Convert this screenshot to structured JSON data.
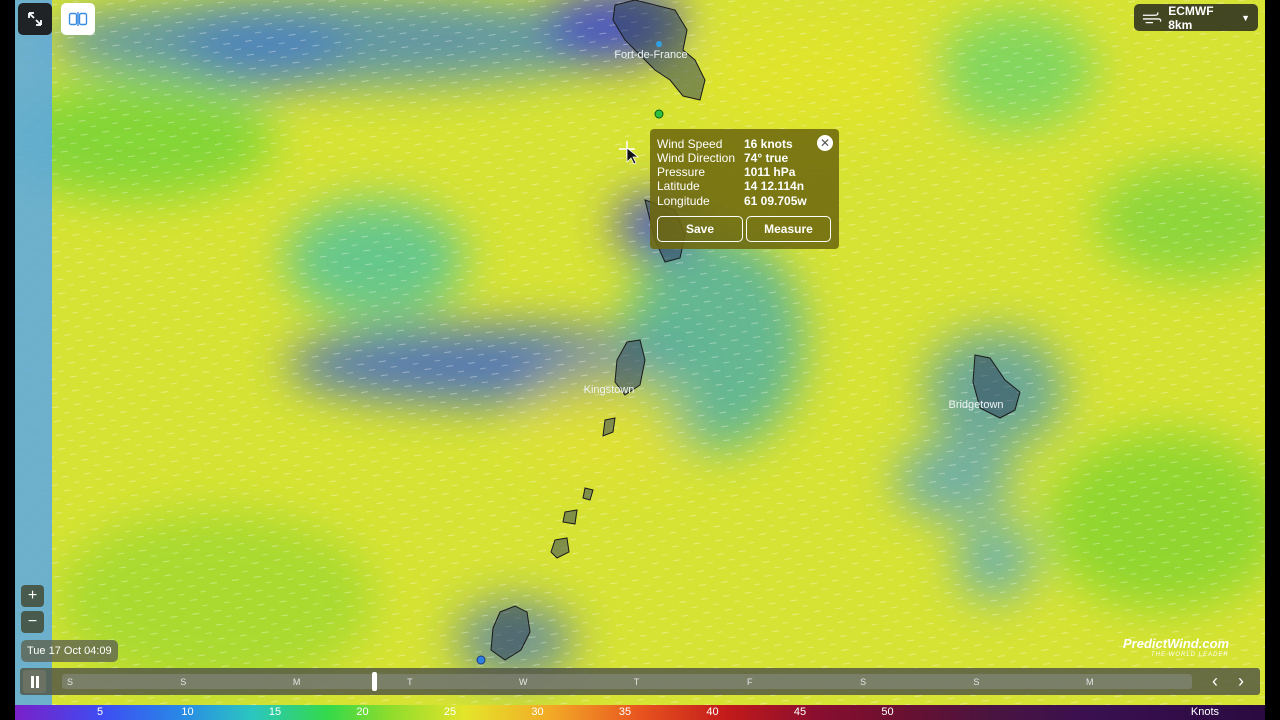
{
  "map": {
    "cities": [
      {
        "name": "Fort-de-France"
      },
      {
        "name": "Kingstown"
      },
      {
        "name": "Bridgetown"
      }
    ]
  },
  "toolbar": {
    "fullscreen_icon": "expand-arrows-icon",
    "split_icon": "split-view-icon",
    "model_label": "ECMWF 8km",
    "model_icon": "wind-lines-icon"
  },
  "zoom": {
    "in_label": "+",
    "out_label": "−"
  },
  "current_time": "Tue 17 Oct 04:09",
  "popup": {
    "rows": [
      {
        "label": "Wind Speed",
        "value": "16 knots"
      },
      {
        "label": "Wind Direction",
        "value": "74° true"
      },
      {
        "label": "Pressure",
        "value": "1011 hPa"
      },
      {
        "label": "Latitude",
        "value": "14 12.114n"
      },
      {
        "label": "Longitude",
        "value": "61 09.705w"
      }
    ],
    "save_label": "Save",
    "measure_label": "Measure",
    "close_icon": "close-icon"
  },
  "timeline": {
    "days": [
      "S",
      "S",
      "M",
      "T",
      "W",
      "T",
      "F",
      "S",
      "S",
      "M"
    ],
    "position_fraction": 0.276,
    "play_icon": "pause-icon"
  },
  "legend": {
    "ticks": [
      "5",
      "10",
      "15",
      "20",
      "25",
      "30",
      "35",
      "40",
      "45",
      "50"
    ],
    "unit": "Knots"
  },
  "brand": {
    "name": "PredictWind.com",
    "tagline": "THE WORLD LEADER"
  }
}
